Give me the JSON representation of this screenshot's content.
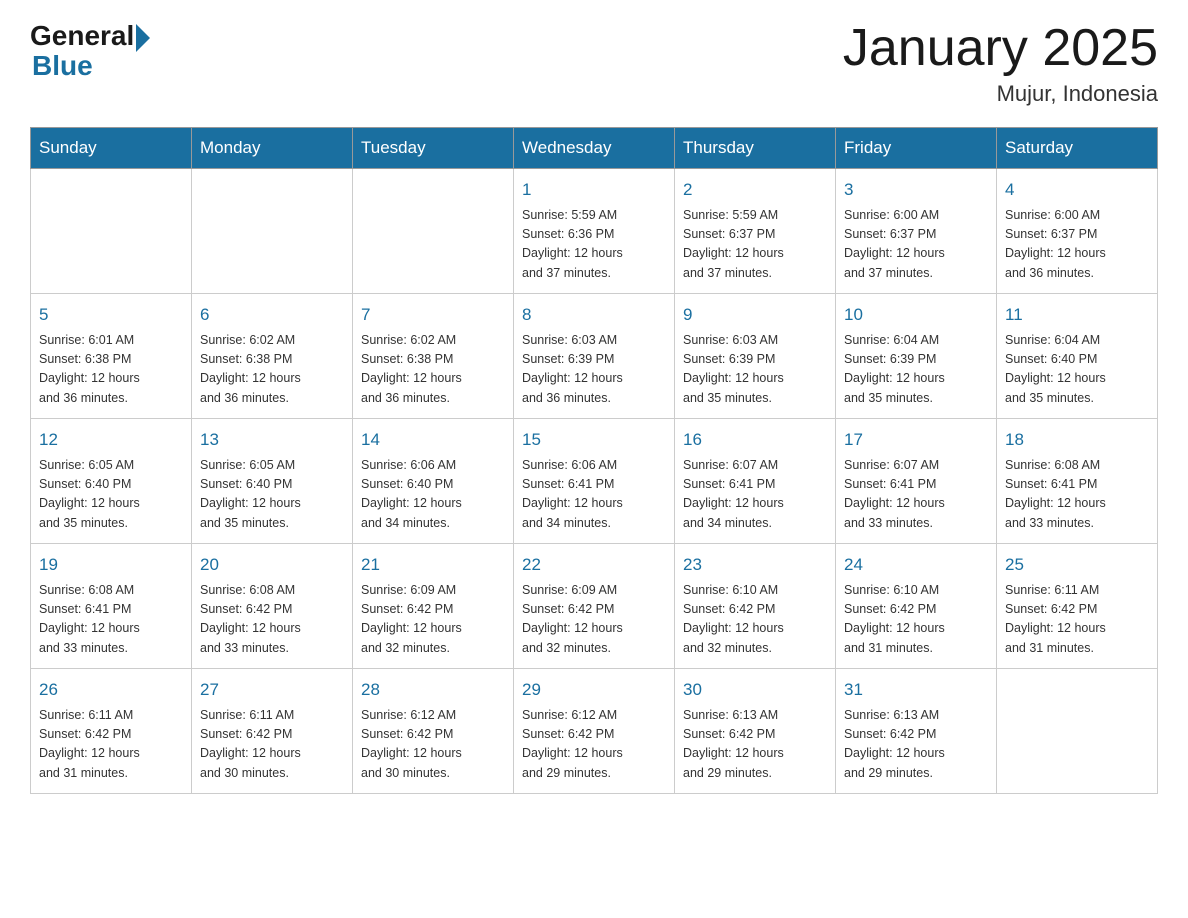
{
  "header": {
    "logo_general": "General",
    "logo_blue": "Blue",
    "month_title": "January 2025",
    "location": "Mujur, Indonesia"
  },
  "calendar": {
    "days_of_week": [
      "Sunday",
      "Monday",
      "Tuesday",
      "Wednesday",
      "Thursday",
      "Friday",
      "Saturday"
    ],
    "weeks": [
      [
        {
          "day": "",
          "info": ""
        },
        {
          "day": "",
          "info": ""
        },
        {
          "day": "",
          "info": ""
        },
        {
          "day": "1",
          "info": "Sunrise: 5:59 AM\nSunset: 6:36 PM\nDaylight: 12 hours\nand 37 minutes."
        },
        {
          "day": "2",
          "info": "Sunrise: 5:59 AM\nSunset: 6:37 PM\nDaylight: 12 hours\nand 37 minutes."
        },
        {
          "day": "3",
          "info": "Sunrise: 6:00 AM\nSunset: 6:37 PM\nDaylight: 12 hours\nand 37 minutes."
        },
        {
          "day": "4",
          "info": "Sunrise: 6:00 AM\nSunset: 6:37 PM\nDaylight: 12 hours\nand 36 minutes."
        }
      ],
      [
        {
          "day": "5",
          "info": "Sunrise: 6:01 AM\nSunset: 6:38 PM\nDaylight: 12 hours\nand 36 minutes."
        },
        {
          "day": "6",
          "info": "Sunrise: 6:02 AM\nSunset: 6:38 PM\nDaylight: 12 hours\nand 36 minutes."
        },
        {
          "day": "7",
          "info": "Sunrise: 6:02 AM\nSunset: 6:38 PM\nDaylight: 12 hours\nand 36 minutes."
        },
        {
          "day": "8",
          "info": "Sunrise: 6:03 AM\nSunset: 6:39 PM\nDaylight: 12 hours\nand 36 minutes."
        },
        {
          "day": "9",
          "info": "Sunrise: 6:03 AM\nSunset: 6:39 PM\nDaylight: 12 hours\nand 35 minutes."
        },
        {
          "day": "10",
          "info": "Sunrise: 6:04 AM\nSunset: 6:39 PM\nDaylight: 12 hours\nand 35 minutes."
        },
        {
          "day": "11",
          "info": "Sunrise: 6:04 AM\nSunset: 6:40 PM\nDaylight: 12 hours\nand 35 minutes."
        }
      ],
      [
        {
          "day": "12",
          "info": "Sunrise: 6:05 AM\nSunset: 6:40 PM\nDaylight: 12 hours\nand 35 minutes."
        },
        {
          "day": "13",
          "info": "Sunrise: 6:05 AM\nSunset: 6:40 PM\nDaylight: 12 hours\nand 35 minutes."
        },
        {
          "day": "14",
          "info": "Sunrise: 6:06 AM\nSunset: 6:40 PM\nDaylight: 12 hours\nand 34 minutes."
        },
        {
          "day": "15",
          "info": "Sunrise: 6:06 AM\nSunset: 6:41 PM\nDaylight: 12 hours\nand 34 minutes."
        },
        {
          "day": "16",
          "info": "Sunrise: 6:07 AM\nSunset: 6:41 PM\nDaylight: 12 hours\nand 34 minutes."
        },
        {
          "day": "17",
          "info": "Sunrise: 6:07 AM\nSunset: 6:41 PM\nDaylight: 12 hours\nand 33 minutes."
        },
        {
          "day": "18",
          "info": "Sunrise: 6:08 AM\nSunset: 6:41 PM\nDaylight: 12 hours\nand 33 minutes."
        }
      ],
      [
        {
          "day": "19",
          "info": "Sunrise: 6:08 AM\nSunset: 6:41 PM\nDaylight: 12 hours\nand 33 minutes."
        },
        {
          "day": "20",
          "info": "Sunrise: 6:08 AM\nSunset: 6:42 PM\nDaylight: 12 hours\nand 33 minutes."
        },
        {
          "day": "21",
          "info": "Sunrise: 6:09 AM\nSunset: 6:42 PM\nDaylight: 12 hours\nand 32 minutes."
        },
        {
          "day": "22",
          "info": "Sunrise: 6:09 AM\nSunset: 6:42 PM\nDaylight: 12 hours\nand 32 minutes."
        },
        {
          "day": "23",
          "info": "Sunrise: 6:10 AM\nSunset: 6:42 PM\nDaylight: 12 hours\nand 32 minutes."
        },
        {
          "day": "24",
          "info": "Sunrise: 6:10 AM\nSunset: 6:42 PM\nDaylight: 12 hours\nand 31 minutes."
        },
        {
          "day": "25",
          "info": "Sunrise: 6:11 AM\nSunset: 6:42 PM\nDaylight: 12 hours\nand 31 minutes."
        }
      ],
      [
        {
          "day": "26",
          "info": "Sunrise: 6:11 AM\nSunset: 6:42 PM\nDaylight: 12 hours\nand 31 minutes."
        },
        {
          "day": "27",
          "info": "Sunrise: 6:11 AM\nSunset: 6:42 PM\nDaylight: 12 hours\nand 30 minutes."
        },
        {
          "day": "28",
          "info": "Sunrise: 6:12 AM\nSunset: 6:42 PM\nDaylight: 12 hours\nand 30 minutes."
        },
        {
          "day": "29",
          "info": "Sunrise: 6:12 AM\nSunset: 6:42 PM\nDaylight: 12 hours\nand 29 minutes."
        },
        {
          "day": "30",
          "info": "Sunrise: 6:13 AM\nSunset: 6:42 PM\nDaylight: 12 hours\nand 29 minutes."
        },
        {
          "day": "31",
          "info": "Sunrise: 6:13 AM\nSunset: 6:42 PM\nDaylight: 12 hours\nand 29 minutes."
        },
        {
          "day": "",
          "info": ""
        }
      ]
    ]
  }
}
